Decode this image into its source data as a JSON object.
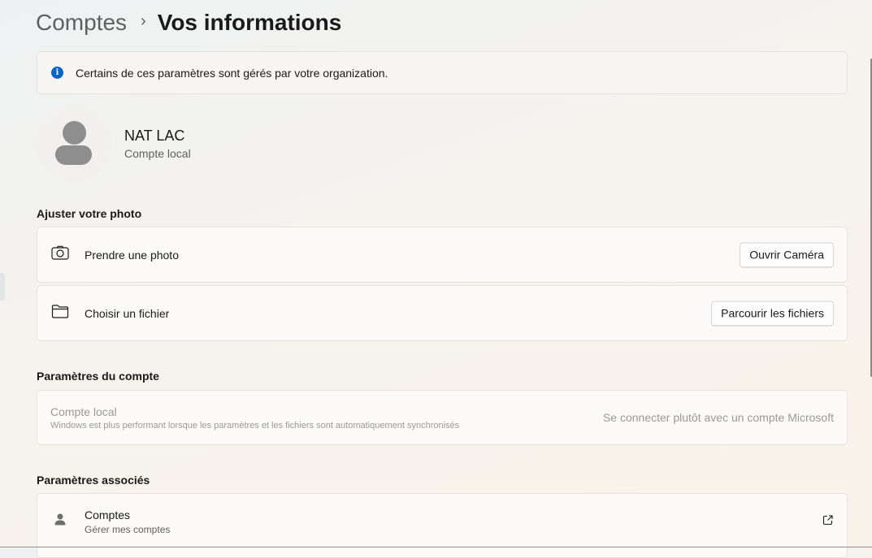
{
  "breadcrumb": {
    "parent": "Comptes",
    "separator": "›",
    "current": "Vos informations"
  },
  "info_banner": {
    "icon": "info-icon",
    "text": "Certains de ces paramètres sont gérés par votre organization.",
    "accent_color": "#0a64c8"
  },
  "user": {
    "name": "NAT LAC",
    "account_type": "Compte local",
    "avatar_icon": "person-placeholder-icon"
  },
  "photo_section": {
    "title": "Ajuster votre photo",
    "items": [
      {
        "icon": "camera-icon",
        "label": "Prendre une photo",
        "button": "Ouvrir Caméra"
      },
      {
        "icon": "folder-icon",
        "label": "Choisir un fichier",
        "button": "Parcourir les fichiers"
      }
    ]
  },
  "account_section": {
    "title": "Paramètres du compte",
    "item": {
      "title": "Compte local",
      "subtitle": "Windows est plus performant lorsque les paramètres et les fichiers sont automatiquement synchronisés",
      "action": "Se connecter plutôt avec un compte Microsoft",
      "disabled": true
    }
  },
  "related_section": {
    "title": "Paramètres associés",
    "items": [
      {
        "icon": "person-icon",
        "title": "Comptes",
        "subtitle": "Gérer mes comptes",
        "action_icon": "open-external-icon"
      }
    ]
  }
}
